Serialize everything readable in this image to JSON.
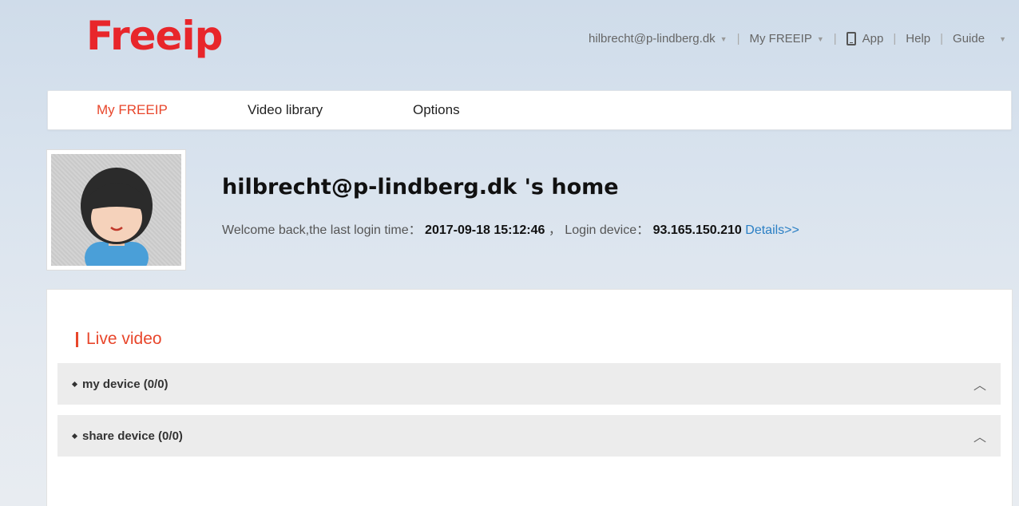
{
  "header": {
    "logo": "Freeip",
    "user_menu": "hilbrecht@p-lindberg.dk",
    "my_freeip_menu": "My FREEIP",
    "app_link": "App",
    "help_link": "Help",
    "guide_menu": "Guide",
    "separator": "|"
  },
  "nav": {
    "tabs": [
      {
        "label": "My FREEIP",
        "active": true
      },
      {
        "label": "Video library",
        "active": false
      },
      {
        "label": "Options",
        "active": false
      }
    ]
  },
  "profile": {
    "title": "hilbrecht@p-lindberg.dk 's home",
    "welcome_prefix": "Welcome back,the last login time：",
    "last_login": "2017-09-18 15:12:46",
    "device_prefix": "， Login device：",
    "device_ip": "93.165.150.210",
    "details_link": "Details>>"
  },
  "live_video": {
    "title": "Live video",
    "groups": [
      {
        "label": "my device (0/0)"
      },
      {
        "label": "share device (0/0)"
      }
    ]
  },
  "colors": {
    "brand": "#e8262b",
    "accent": "#e8462b",
    "link": "#2a7fc4"
  }
}
